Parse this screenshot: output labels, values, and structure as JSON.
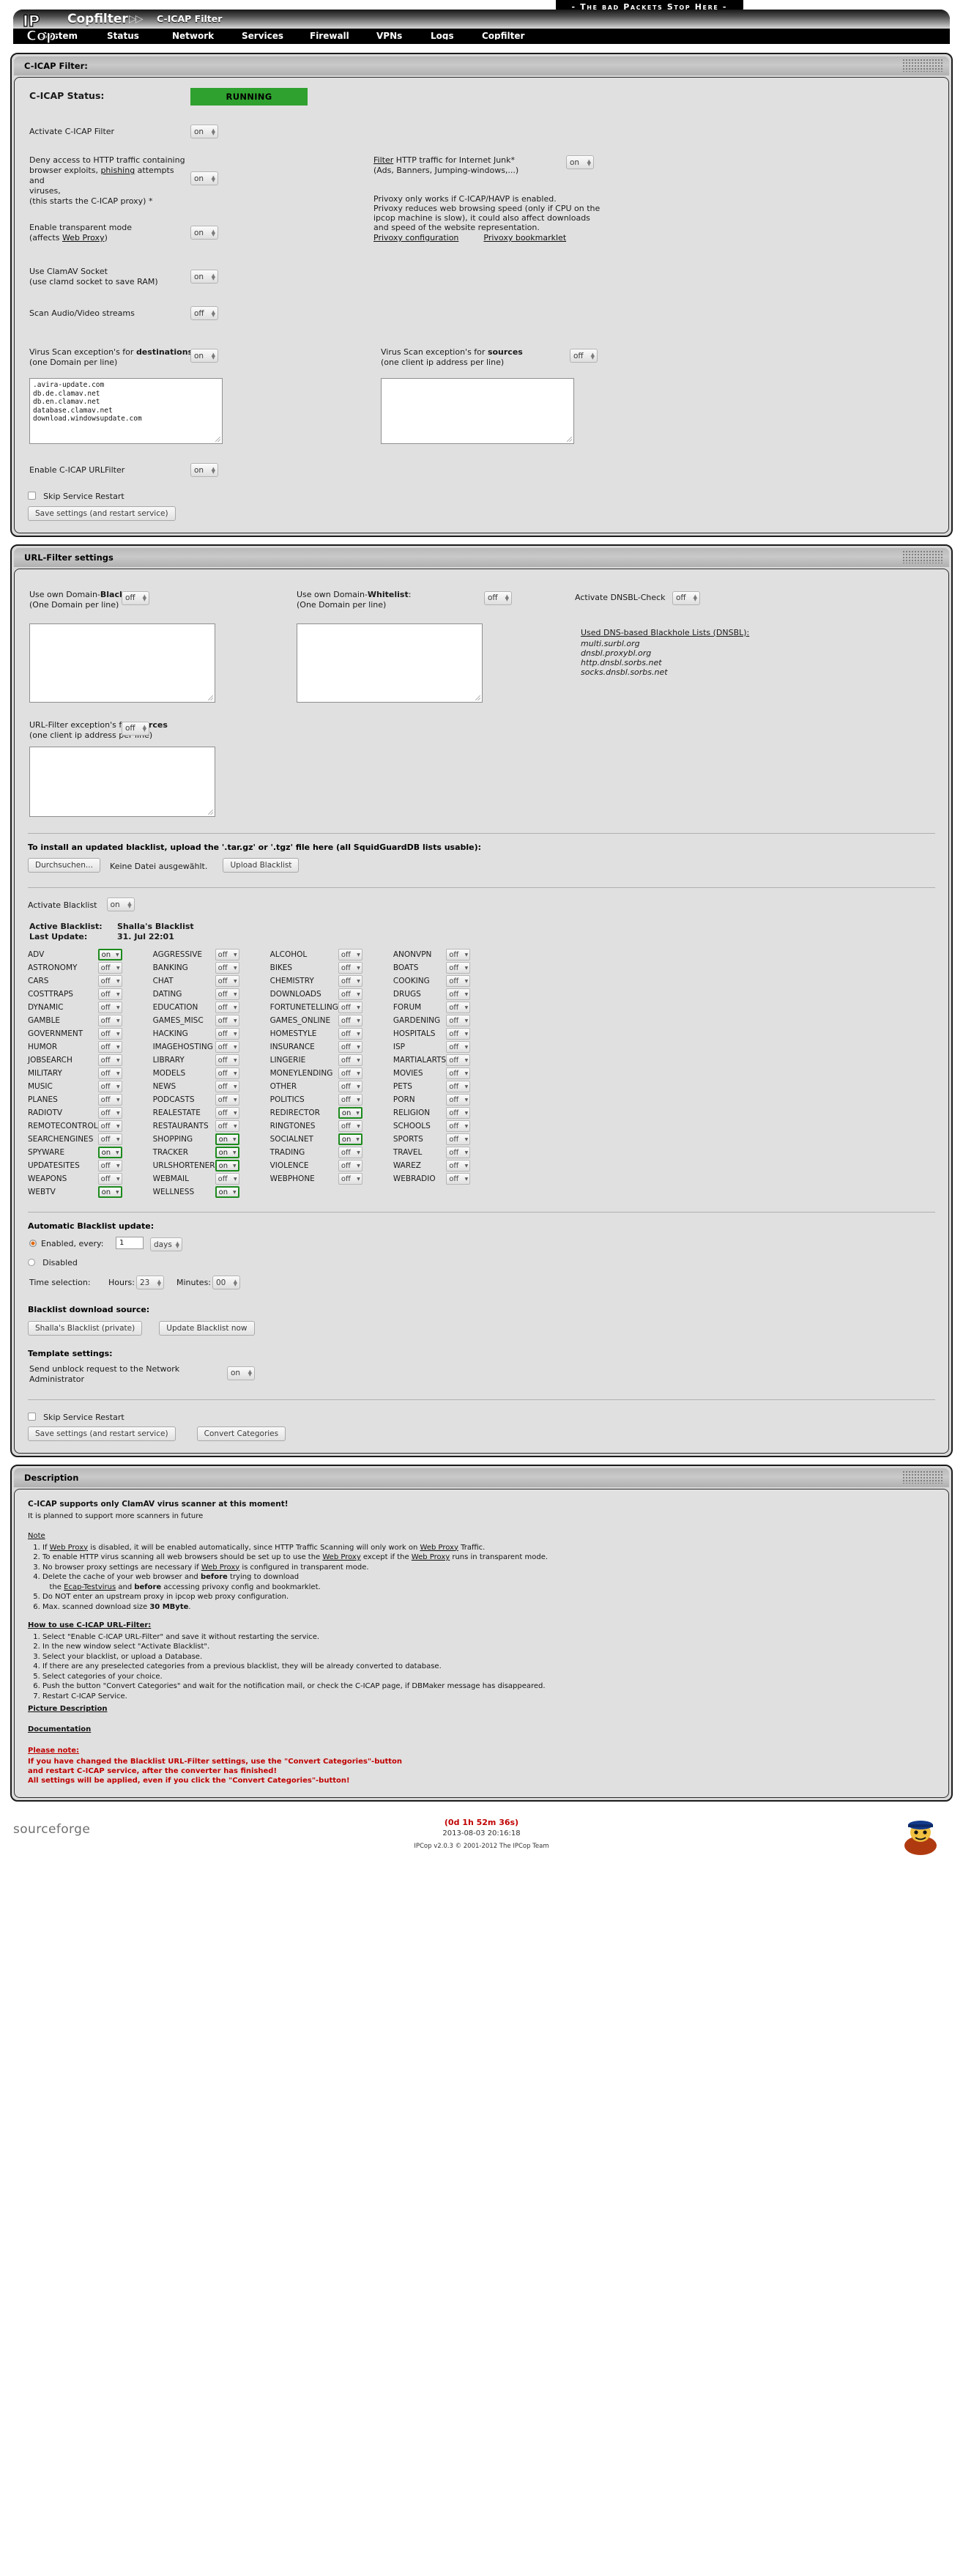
{
  "banner": {
    "slogan": "- The bad Packets Stop Here -"
  },
  "header": {
    "brand": "Copfilter",
    "chevrons": "▷▷",
    "subtitle": "C-ICAP Filter",
    "menu": [
      "System",
      "Status",
      "Network",
      "Services",
      "Firewall",
      "VPNs",
      "Logs",
      "Copfilter"
    ]
  },
  "cicap": {
    "panel_title": "C-ICAP Filter:",
    "status_label": "C-ICAP Status:",
    "status_value": "RUNNING",
    "status_color": "#2fa12f",
    "activate_label": "Activate C-ICAP Filter",
    "activate_value": "on",
    "deny_label_l1": "Deny access to HTTP traffic containing",
    "deny_label_l2a": "browser exploits, ",
    "deny_label_l2link": "phishing",
    "deny_label_l2b": " attempts and",
    "deny_label_l3": "viruses,",
    "deny_label_l4": "(this starts the C-ICAP proxy) *",
    "deny_value": "on",
    "junk_link": "Filter",
    "junk_l1": " HTTP traffic for Internet Junk*",
    "junk_l2": "(Ads, Banners, Jumping-windows,...)",
    "junk_value": "on",
    "privoxy_note1": "Privoxy only works if C-ICAP/HAVP is enabled.",
    "privoxy_note2": "Privoxy reduces web browsing speed (only if CPU on the",
    "privoxy_note3": "ipcop machine is slow), it could also affect downloads",
    "privoxy_note4": "and speed of the website representation.",
    "privoxy_config_link": "Privoxy configuration",
    "privoxy_bookmarklet_link": "Privoxy bookmarklet",
    "transparent_l1": "Enable transparent mode",
    "transparent_l2a": "(affects ",
    "transparent_l2link": "Web Proxy",
    "transparent_l2b": ")",
    "transparent_value": "on",
    "clamav_l1": "Use ClamAV Socket",
    "clamav_l2": "(use clamd socket to save RAM)",
    "clamav_value": "on",
    "av_label": "Scan Audio/Video streams",
    "av_value": "off",
    "exc_dest_l1a": "Virus Scan exception's for ",
    "exc_dest_l1b": "destinations",
    "exc_dest_l2": "(one Domain per line)",
    "exc_dest_value": "on",
    "exc_dest_text": ".avira-update.com\ndb.de.clamav.net\ndb.en.clamav.net\ndatabase.clamav.net\ndownload.windowsupdate.com",
    "exc_src_l1a": "Virus Scan exception's for ",
    "exc_src_l1b": "sources",
    "exc_src_l2": "(one client ip address per line)",
    "exc_src_value": "off",
    "exc_src_text": "",
    "urlfilter_label": "Enable C-ICAP URLFilter",
    "urlfilter_value": "on",
    "skip_restart": "Skip Service Restart",
    "save_button": "Save settings (and restart service)"
  },
  "urlfilter": {
    "panel_title": "URL-Filter settings",
    "blacklist_l1a": "Use own Domain-",
    "blacklist_l1b": "Blacklist",
    "blacklist_l1c": ":",
    "blacklist_l2": "(One Domain per line)",
    "blacklist_value": "off",
    "blacklist_text": "",
    "whitelist_l1a": "Use own Domain-",
    "whitelist_l1b": "Whitelist",
    "whitelist_l1c": ":",
    "whitelist_l2": "(One Domain per line)",
    "whitelist_value": "off",
    "whitelist_text": "",
    "dnsbl_label": "Activate DNSBL-Check",
    "dnsbl_value": "off",
    "dnsbl_heading": "Used DNS-based Blackhole Lists (DNSBL):",
    "dnsbl_lists": [
      "multi.surbl.org",
      "dnsbl.proxybl.org",
      "http.dnsbl.sorbs.net",
      "socks.dnsbl.sorbs.net"
    ],
    "exc_src_l1a": "URL-Filter exception's for ",
    "exc_src_l1b": "sources",
    "exc_src_l2": "(one client ip address per line)",
    "exc_src_value": "off",
    "exc_src_text": "",
    "upload_heading": "To install an updated blacklist, upload the '.tar.gz' or '.tgz' file here (all SquidGuardDB lists usable):",
    "file_browse_button": "Durchsuchen...",
    "file_status": "Keine Datei ausgewählt.",
    "upload_button": "Upload Blacklist",
    "activate_blacklist_label": "Activate Blacklist",
    "activate_blacklist_value": "on",
    "active_blacklist_label": "Active Blacklist:",
    "active_blacklist_value": "Shalla's Blacklist",
    "last_update_label": "Last Update:",
    "last_update_value": "31. Jul 22:01",
    "categories": [
      {
        "name": "ADV",
        "value": "on"
      },
      {
        "name": "AGGRESSIVE",
        "value": "off"
      },
      {
        "name": "ALCOHOL",
        "value": "off"
      },
      {
        "name": "ANONVPN",
        "value": "off"
      },
      {
        "name": "ASTRONOMY",
        "value": "off"
      },
      {
        "name": "BANKING",
        "value": "off"
      },
      {
        "name": "BIKES",
        "value": "off"
      },
      {
        "name": "BOATS",
        "value": "off"
      },
      {
        "name": "CARS",
        "value": "off"
      },
      {
        "name": "CHAT",
        "value": "off"
      },
      {
        "name": "CHEMISTRY",
        "value": "off"
      },
      {
        "name": "COOKING",
        "value": "off"
      },
      {
        "name": "COSTTRAPS",
        "value": "off"
      },
      {
        "name": "DATING",
        "value": "off"
      },
      {
        "name": "DOWNLOADS",
        "value": "off"
      },
      {
        "name": "DRUGS",
        "value": "off"
      },
      {
        "name": "DYNAMIC",
        "value": "off"
      },
      {
        "name": "EDUCATION",
        "value": "off"
      },
      {
        "name": "FORTUNETELLING",
        "value": "off"
      },
      {
        "name": "FORUM",
        "value": "off"
      },
      {
        "name": "GAMBLE",
        "value": "off"
      },
      {
        "name": "GAMES_MISC",
        "value": "off"
      },
      {
        "name": "GAMES_ONLINE",
        "value": "off"
      },
      {
        "name": "GARDENING",
        "value": "off"
      },
      {
        "name": "GOVERNMENT",
        "value": "off"
      },
      {
        "name": "HACKING",
        "value": "off"
      },
      {
        "name": "HOMESTYLE",
        "value": "off"
      },
      {
        "name": "HOSPITALS",
        "value": "off"
      },
      {
        "name": "HUMOR",
        "value": "off"
      },
      {
        "name": "IMAGEHOSTING",
        "value": "off"
      },
      {
        "name": "INSURANCE",
        "value": "off"
      },
      {
        "name": "ISP",
        "value": "off"
      },
      {
        "name": "JOBSEARCH",
        "value": "off"
      },
      {
        "name": "LIBRARY",
        "value": "off"
      },
      {
        "name": "LINGERIE",
        "value": "off"
      },
      {
        "name": "MARTIALARTS",
        "value": "off"
      },
      {
        "name": "MILITARY",
        "value": "off"
      },
      {
        "name": "MODELS",
        "value": "off"
      },
      {
        "name": "MONEYLENDING",
        "value": "off"
      },
      {
        "name": "MOVIES",
        "value": "off"
      },
      {
        "name": "MUSIC",
        "value": "off"
      },
      {
        "name": "NEWS",
        "value": "off"
      },
      {
        "name": "OTHER",
        "value": "off"
      },
      {
        "name": "PETS",
        "value": "off"
      },
      {
        "name": "PLANES",
        "value": "off"
      },
      {
        "name": "PODCASTS",
        "value": "off"
      },
      {
        "name": "POLITICS",
        "value": "off"
      },
      {
        "name": "PORN",
        "value": "off"
      },
      {
        "name": "RADIOTV",
        "value": "off"
      },
      {
        "name": "REALESTATE",
        "value": "off"
      },
      {
        "name": "REDIRECTOR",
        "value": "on"
      },
      {
        "name": "RELIGION",
        "value": "off"
      },
      {
        "name": "REMOTECONTROL",
        "value": "off"
      },
      {
        "name": "RESTAURANTS",
        "value": "off"
      },
      {
        "name": "RINGTONES",
        "value": "off"
      },
      {
        "name": "SCHOOLS",
        "value": "off"
      },
      {
        "name": "SEARCHENGINES",
        "value": "off"
      },
      {
        "name": "SHOPPING",
        "value": "on"
      },
      {
        "name": "SOCIALNET",
        "value": "on"
      },
      {
        "name": "SPORTS",
        "value": "off"
      },
      {
        "name": "SPYWARE",
        "value": "on"
      },
      {
        "name": "TRACKER",
        "value": "on"
      },
      {
        "name": "TRADING",
        "value": "off"
      },
      {
        "name": "TRAVEL",
        "value": "off"
      },
      {
        "name": "UPDATESITES",
        "value": "off"
      },
      {
        "name": "URLSHORTENER",
        "value": "on"
      },
      {
        "name": "VIOLENCE",
        "value": "off"
      },
      {
        "name": "WAREZ",
        "value": "off"
      },
      {
        "name": "WEAPONS",
        "value": "off"
      },
      {
        "name": "WEBMAIL",
        "value": "off"
      },
      {
        "name": "WEBPHONE",
        "value": "off"
      },
      {
        "name": "WEBRADIO",
        "value": "off"
      },
      {
        "name": "WEBTV",
        "value": "on"
      },
      {
        "name": "WELLNESS",
        "value": "on"
      }
    ],
    "auto_update_heading": "Automatic Blacklist update:",
    "enabled_every_label": "Enabled, every:",
    "enabled_every_value": "1",
    "days_select": "days",
    "disabled_label": "Disabled",
    "time_selection_label": "Time selection:",
    "hours_label": "Hours:",
    "hours_value": "23",
    "minutes_label": "Minutes:",
    "minutes_value": "00",
    "download_source_heading": "Blacklist download source:",
    "download_source_value": "Shalla's Blacklist (private)",
    "update_now_button": "Update Blacklist now",
    "template_heading": "Template settings:",
    "template_l1": "Send unblock request to the Network",
    "template_l2": "Administrator",
    "template_value": "on",
    "skip_restart": "Skip Service Restart",
    "save_button": "Save settings (and restart service)",
    "convert_button": "Convert Categories"
  },
  "description": {
    "panel_title": "Description",
    "heading1": "C-ICAP supports only ClamAV virus scanner at this moment!",
    "heading2": "It is planned to support more scanners in future",
    "note_title": "Note",
    "notes": [
      "If Web Proxy is disabled, it will be enabled automatically, since HTTP Traffic Scanning will only work on Web Proxy Traffic.",
      "To enable HTTP virus scanning all web browsers should be set up to use the Web Proxy except if the Web Proxy runs in transparent mode.",
      "No browser proxy settings are necessary if Web Proxy is configured in transparent mode.",
      "Delete the cache of your web browser and before trying to download",
      "Do NOT enter an upstream proxy in ipcop web proxy configuration.",
      "Max. scanned download size 30 MByte."
    ],
    "note4_sub": "the Ecap-Testvirus and before accessing privoxy config and bookmarklet.",
    "howto_title": "How to use C-ICAP URL-Filter:",
    "howto": [
      "Select \"Enable C-ICAP URL-Filter\" and save it without restarting the service.",
      "In the new window select \"Activate Blacklist\".",
      "Select your blacklist, or upload a Database.",
      "If there are any preselected categories from a previous blacklist, they will be already converted to database.",
      "Select categories of your choice.",
      "Push the button \"Convert Categories\" and wait for the notification mail, or check the C-ICAP page, if DBMaker message has disappeared.",
      "Restart C-ICAP Service."
    ],
    "picture_link": "Picture Description",
    "documentation_link": "Documentation",
    "please_note_title": "Please note:",
    "please_note": [
      "If you have changed the Blacklist URL-Filter settings, use the \"Convert Categories\"-button",
      "and restart C-ICAP service, after the converter has finished!",
      "All settings will be applied, even if you click the \"Convert Categories\"-button!"
    ]
  },
  "footer": {
    "sourceforge": "sourceforge",
    "uptime": "(0d 1h 52m 36s)",
    "datetime": "2013-08-03 20:16:18",
    "version": "IPCop v2.0.3 © 2001-2012 The IPCop Team"
  }
}
